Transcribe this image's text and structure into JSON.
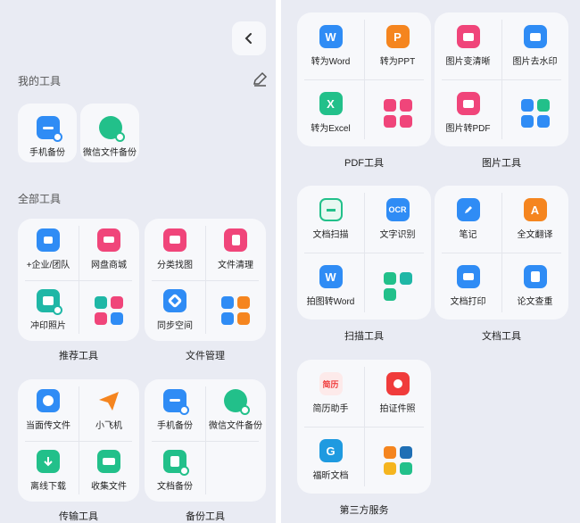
{
  "left": {
    "my_tools_title": "我的工具",
    "all_tools_title": "全部工具",
    "my_tools": [
      {
        "label": "手机备份",
        "icon": "phone-backup-icon"
      },
      {
        "label": "微信文件备份",
        "icon": "wechat-backup-icon"
      }
    ],
    "cards": {
      "recommend": {
        "caption": "推荐工具",
        "items": [
          "+企业/团队",
          "网盘商城",
          "冲印照片",
          ""
        ]
      },
      "file_mgmt": {
        "caption": "文件管理",
        "items": [
          "分类找图",
          "文件清理",
          "同步空间",
          ""
        ]
      },
      "transfer": {
        "caption": "传输工具",
        "items": [
          "当面传文件",
          "小飞机",
          "离线下载",
          "收集文件"
        ]
      },
      "backup": {
        "caption": "备份工具",
        "items": [
          "手机备份",
          "微信文件备份",
          "文档备份",
          ""
        ]
      }
    }
  },
  "right": {
    "cards": {
      "pdf": {
        "caption": "PDF工具",
        "items": [
          "转为Word",
          "转为PPT",
          "转为Excel",
          ""
        ]
      },
      "image": {
        "caption": "图片工具",
        "items": [
          "图片变清晰",
          "图片去水印",
          "图片转PDF",
          ""
        ]
      },
      "scan": {
        "caption": "扫描工具",
        "items": [
          "文档扫描",
          "文字识别",
          "拍图转Word",
          ""
        ]
      },
      "doc": {
        "caption": "文档工具",
        "items": [
          "笔记",
          "全文翻译",
          "文档打印",
          "论文查重"
        ]
      },
      "third": {
        "caption": "第三方服务",
        "items": [
          "简历助手",
          "拍证件照",
          "福昕文档",
          ""
        ]
      }
    },
    "icon_text": {
      "ocr": "OCR",
      "word": "W",
      "ppt": "P",
      "excel": "X",
      "resume": "简历"
    }
  },
  "colors": {
    "blue": "#2f8cf5",
    "orange": "#f5851f",
    "green": "#22c08a",
    "pink": "#f0457a",
    "red": "#f03b3b",
    "teal": "#1fb7a6"
  }
}
